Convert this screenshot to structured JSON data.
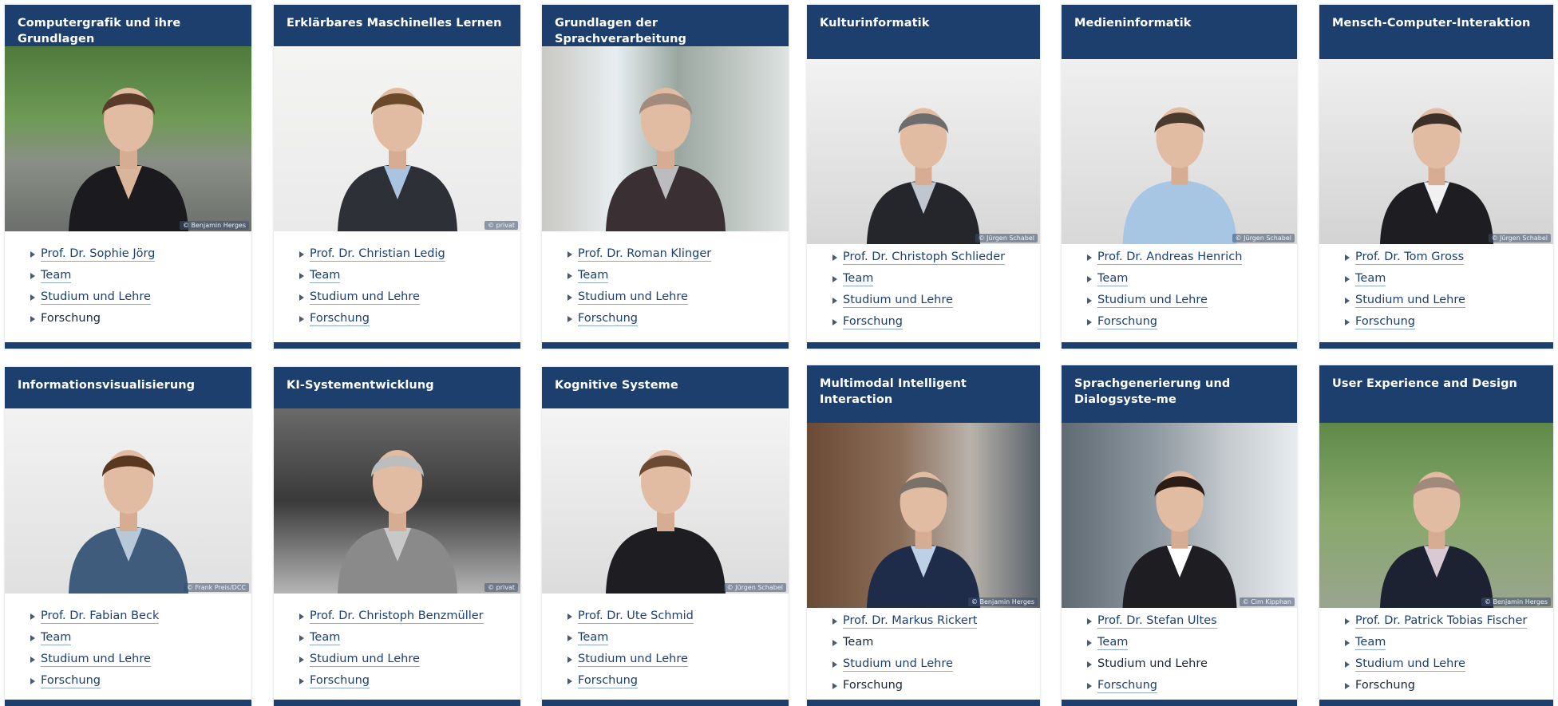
{
  "colors": {
    "header": "#1c3f6e",
    "link": "#1c3f6e",
    "underline": "#8fa8c8"
  },
  "link_icon": "triangle-right-icon",
  "cards": [
    {
      "title": "Computergrafik und ihre Grundlagen",
      "photo_credit": "© Benjamin Herges",
      "links": [
        {
          "label": "Prof. Dr. Sophie Jörg",
          "linked": true
        },
        {
          "label": "Team",
          "linked": true
        },
        {
          "label": "Studium und Lehre",
          "linked": true
        },
        {
          "label": "Forschung",
          "linked": false
        }
      ]
    },
    {
      "title": "Erklärbares Maschinelles Lernen",
      "photo_credit": "© privat",
      "links": [
        {
          "label": "Prof. Dr. Christian Ledig",
          "linked": true
        },
        {
          "label": "Team",
          "linked": true
        },
        {
          "label": "Studium und Lehre",
          "linked": true
        },
        {
          "label": "Forschung",
          "linked": true
        }
      ]
    },
    {
      "title": "Grundlagen der Sprachverarbeitung",
      "photo_credit": "",
      "links": [
        {
          "label": "Prof. Dr. Roman Klinger",
          "linked": true
        },
        {
          "label": "Team",
          "linked": true
        },
        {
          "label": "Studium und Lehre",
          "linked": true
        },
        {
          "label": "Forschung",
          "linked": true
        }
      ]
    },
    {
      "title": "Kulturinformatik",
      "photo_credit": "© Jürgen Schabel",
      "links": [
        {
          "label": "Prof. Dr. Christoph Schlieder",
          "linked": true
        },
        {
          "label": "Team",
          "linked": true
        },
        {
          "label": "Studium und Lehre",
          "linked": true
        },
        {
          "label": "Forschung",
          "linked": true
        }
      ]
    },
    {
      "title": "Medieninformatik",
      "photo_credit": "© Jürgen Schabel",
      "links": [
        {
          "label": "Prof. Dr. Andreas Henrich",
          "linked": true
        },
        {
          "label": "Team",
          "linked": true
        },
        {
          "label": "Studium und Lehre",
          "linked": true
        },
        {
          "label": "Forschung",
          "linked": true
        }
      ]
    },
    {
      "title": "Mensch-Computer-Interaktion",
      "photo_credit": "© Jürgen Schabel",
      "links": [
        {
          "label": "Prof. Dr. Tom Gross",
          "linked": true
        },
        {
          "label": "Team",
          "linked": true
        },
        {
          "label": "Studium und Lehre",
          "linked": true
        },
        {
          "label": "Forschung",
          "linked": true
        }
      ]
    },
    {
      "title": "Informationsvisualisierung",
      "photo_credit": "© Frank Preis/DCC",
      "links": [
        {
          "label": "Prof. Dr. Fabian Beck",
          "linked": true
        },
        {
          "label": "Team",
          "linked": true
        },
        {
          "label": "Studium und Lehre",
          "linked": true
        },
        {
          "label": "Forschung",
          "linked": true
        }
      ]
    },
    {
      "title": "KI-Systementwicklung",
      "photo_credit": "© privat",
      "links": [
        {
          "label": "Prof. Dr. Christoph Benzmüller",
          "linked": true
        },
        {
          "label": "Team",
          "linked": true
        },
        {
          "label": "Studium und Lehre",
          "linked": true
        },
        {
          "label": "Forschung",
          "linked": true
        }
      ]
    },
    {
      "title": "Kognitive Systeme",
      "photo_credit": "© Jürgen Schabel",
      "links": [
        {
          "label": "Prof. Dr. Ute Schmid",
          "linked": true
        },
        {
          "label": "Team",
          "linked": true
        },
        {
          "label": "Studium und Lehre",
          "linked": true
        },
        {
          "label": "Forschung",
          "linked": true
        }
      ]
    },
    {
      "title": "Multimodal Intelligent Interaction",
      "photo_credit": "© Benjamin Herges",
      "links": [
        {
          "label": "Prof. Dr. Markus Rickert",
          "linked": true
        },
        {
          "label": "Team",
          "linked": false
        },
        {
          "label": "Studium und Lehre",
          "linked": true
        },
        {
          "label": "Forschung",
          "linked": false
        }
      ]
    },
    {
      "title": "Sprachgenerierung und Dialogsyste-me",
      "photo_credit": "© Cim Kipphan",
      "links": [
        {
          "label": "Prof. Dr. Stefan Ultes",
          "linked": true
        },
        {
          "label": "Team",
          "linked": true
        },
        {
          "label": "Studium und Lehre",
          "linked": false
        },
        {
          "label": "Forschung",
          "linked": true
        }
      ]
    },
    {
      "title": "User Experience and Design",
      "photo_credit": "© Benjamin Herges",
      "links": [
        {
          "label": "Prof. Dr. Patrick Tobias Fischer",
          "linked": true
        },
        {
          "label": "Team",
          "linked": true
        },
        {
          "label": "Studium und Lehre",
          "linked": true
        },
        {
          "label": "Forschung",
          "linked": false
        }
      ]
    }
  ]
}
